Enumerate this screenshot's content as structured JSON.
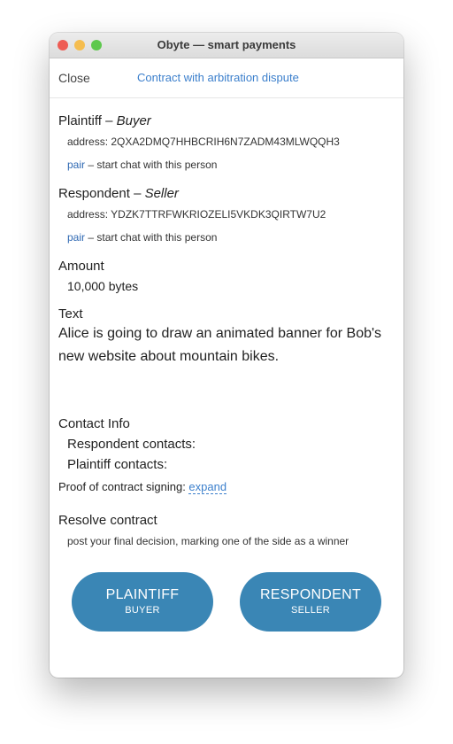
{
  "window": {
    "title": "Obyte — smart payments"
  },
  "topbar": {
    "close_label": "Close",
    "title": "Contract with arbitration dispute"
  },
  "plaintiff": {
    "heading": "Plaintiff – ",
    "role": "Buyer",
    "address_label": "address: ",
    "address": "2QXA2DMQ7HHBCRIH6N7ZADM43MLWQQH3",
    "pair_label": "pair",
    "pair_desc": " – start chat with this person"
  },
  "respondent": {
    "heading": "Respondent – ",
    "role": "Seller",
    "address_label": "address: ",
    "address": "YDZK7TTRFWKRIOZELI5VKDK3QIRTW7U2",
    "pair_label": "pair",
    "pair_desc": " – start chat with this person"
  },
  "amount": {
    "heading": "Amount",
    "value": "10,000 bytes"
  },
  "text": {
    "heading": "Text",
    "line1": "Alice is going to draw an animated banner for Bob's",
    "line2": "new website about mountain bikes."
  },
  "contact": {
    "heading": "Contact Info",
    "respondent_label": "Respondent contacts:",
    "plaintiff_label": "Plaintiff contacts:"
  },
  "proof": {
    "label": "Proof of contract signing: ",
    "expand_label": "expand"
  },
  "resolve": {
    "heading": "Resolve contract",
    "desc": "post your final decision, marking one of the side as a winner"
  },
  "buttons": {
    "plaintiff_main": "PLAINTIFF",
    "plaintiff_sub": "BUYER",
    "respondent_main": "RESPONDENT",
    "respondent_sub": "SELLER"
  },
  "colors": {
    "accent": "#3b7fcc",
    "button": "#3a86b5",
    "link": "#2f69b3"
  },
  "icons": [
    "close-traffic-light",
    "minimize-traffic-light",
    "maximize-traffic-light"
  ]
}
